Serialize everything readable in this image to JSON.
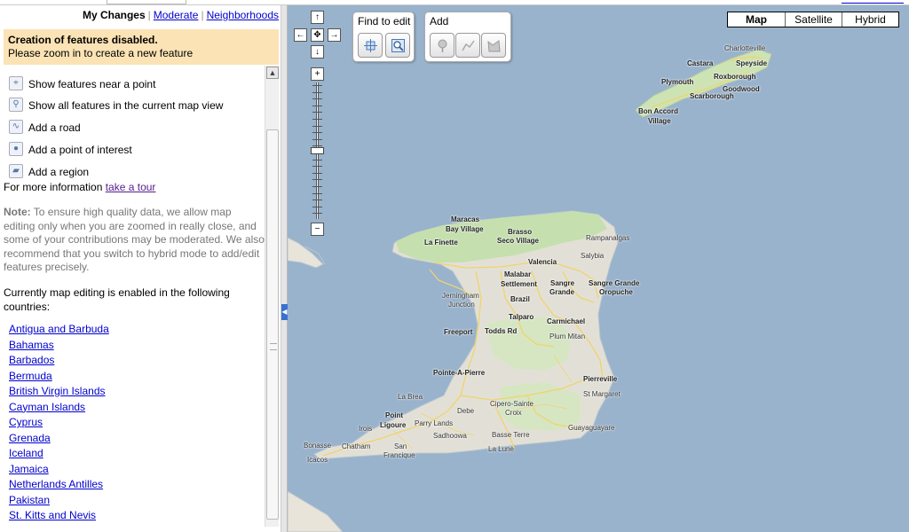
{
  "header_links": {
    "my_changes": "My Changes",
    "moderate": "Moderate",
    "neighborhoods": "Neighborhoods"
  },
  "warning": {
    "title": "Creation of features disabled.",
    "body": "Please zoom in to create a new feature"
  },
  "tools": [
    {
      "label": "Show features near a point",
      "icon": "crosshair-icon"
    },
    {
      "label": "Show all features in the current map view",
      "icon": "magnifier-icon"
    },
    {
      "label": "Add a road",
      "icon": "road-line-icon"
    },
    {
      "label": "Add a point of interest",
      "icon": "pin-icon"
    },
    {
      "label": "Add a region",
      "icon": "polygon-icon"
    }
  ],
  "more_info": {
    "prefix": "For more information",
    "link": "take a tour"
  },
  "note": {
    "label": "Note:",
    "text": "To ensure high quality data, we allow map editing only when you are zoomed in really close, and some of your contributions may be moderated. We also recommend that you switch to hybrid mode to add/edit features precisely."
  },
  "enabled_intro": "Currently map editing is enabled in the following countries:",
  "countries": [
    "Antigua and Barbuda",
    "Bahamas",
    "Barbados",
    "Bermuda",
    "British Virgin Islands",
    "Cayman Islands",
    "Cyprus",
    "Grenada",
    "Iceland",
    "Jamaica",
    "Netherlands Antilles",
    "Pakistan",
    "St. Kitts and Nevis"
  ],
  "map_controls": {
    "find_to_edit": "Find to edit",
    "add": "Add",
    "zoom_in": "+",
    "zoom_out": "−",
    "pan_up": "↑",
    "pan_down": "↓",
    "pan_left": "←",
    "pan_right": "→",
    "pan_center": "✥"
  },
  "map_types": [
    "Map",
    "Satellite",
    "Hybrid"
  ],
  "map_type_selected": "Map",
  "places": [
    "Charlotteville",
    "Castara",
    "Speyside",
    "Roxborough",
    "Plymouth",
    "Goodwood",
    "Scarborough",
    "Bon Accord",
    "Village",
    "Maracas",
    "Bay Village",
    "Brasso",
    "Seco Village",
    "La Finette",
    "Rampanalgas",
    "Salybia",
    "Valencia",
    "Malabar",
    "Settlement",
    "Sangre",
    "Grande",
    "Sangre Grande",
    "Oropuche",
    "Jerningham",
    "Junction",
    "Brazil",
    "Talparo",
    "Carmichael",
    "Freeport",
    "Todds Rd",
    "Plum Mitan",
    "Pointe-A-Pierre",
    "Pierreville",
    "St Margaret",
    "La Brea",
    "Cipero-Sainte",
    "Croix",
    "Debe",
    "Point",
    "Ligoure",
    "Irois",
    "Parry Lands",
    "Sadhoowa",
    "Basse Terre",
    "Guayaguayare",
    "Bonasse",
    "Chatham",
    "San",
    "Francique",
    "La Lune",
    "Icacos"
  ]
}
